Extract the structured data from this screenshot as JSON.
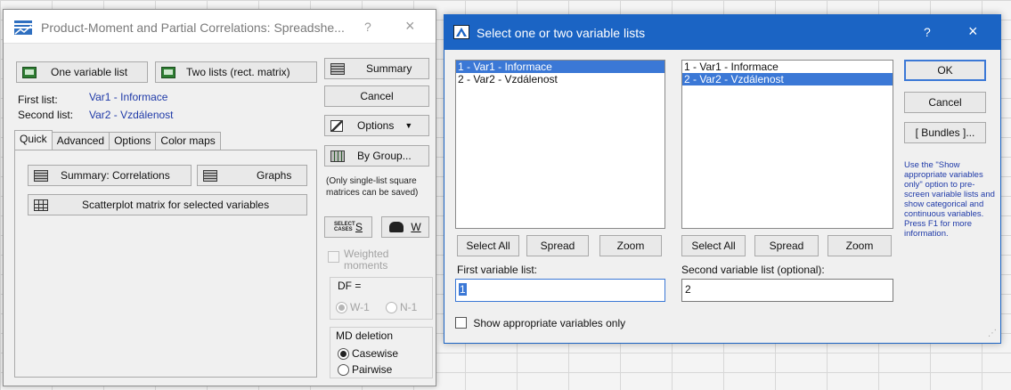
{
  "left_dialog": {
    "title": "Product-Moment and Partial Correlations: Spreadshe...",
    "help": "?",
    "close": "×",
    "one_list_btn": "One variable list",
    "two_lists_btn": "Two lists (rect. matrix)",
    "first_list_label": "First list:",
    "first_list_value": "Var1 - Informace",
    "second_list_label": "Second list:",
    "second_list_value": "Var2 - Vzdálenost",
    "tabs": [
      "Quick",
      "Advanced",
      "Options",
      "Color maps"
    ],
    "summary_correlations_btn": "Summary: Correlations",
    "graphs_btn": "Graphs",
    "scatterplot_btn": "Scatterplot matrix for selected variables",
    "summary_btn": "Summary",
    "cancel_btn": "Cancel",
    "options_btn": "Options",
    "bygroup_btn": "By Group...",
    "note": "(Only single-list square matrices can be saved)",
    "select_cases_icon_text": "SELECT CASES",
    "s_btn": "S",
    "w_btn": "W",
    "weighted_label": "Weighted moments",
    "df_label": "DF =",
    "df_w1": "W-1",
    "df_n1": "N-1",
    "md_deletion_label": "MD deletion",
    "casewise": "Casewise",
    "pairwise": "Pairwise"
  },
  "right_dialog": {
    "title": "Select one or two variable lists",
    "help": "?",
    "close": "×",
    "list1_items": [
      "1 - Var1 - Informace",
      "2 - Var2 - Vzdálenost"
    ],
    "list2_items": [
      "1 - Var1 - Informace",
      "2 - Var2 - Vzdálenost"
    ],
    "select_all": "Select All",
    "spread": "Spread",
    "zoom": "Zoom",
    "first_var_label": "First variable list:",
    "first_var_value": "1",
    "second_var_label": "Second variable list (optional):",
    "second_var_value": "2",
    "show_appropriate": "Show appropriate variables only",
    "ok": "OK",
    "cancel": "Cancel",
    "bundles": "[ Bundles ]...",
    "info_text": "Use the \"Show appropriate variables only\" option to pre-screen variable lists and show categorical and continuous variables. Press F1 for more information."
  }
}
